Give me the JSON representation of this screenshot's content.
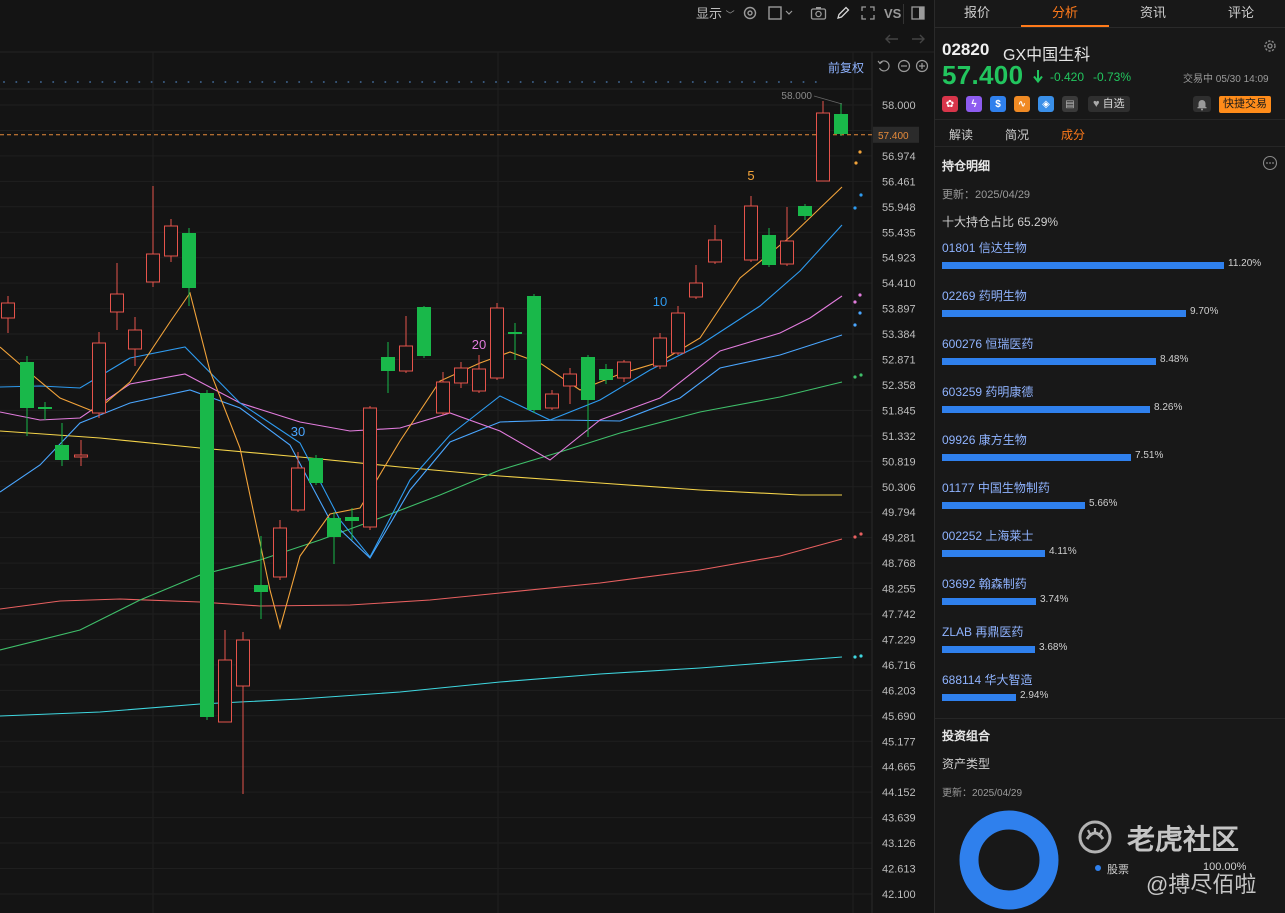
{
  "toolbar": {
    "display_label": "显示",
    "vs_label": "VS"
  },
  "chart": {
    "adj_label": "前复权",
    "current_price_label": "57.400",
    "high_label": "58.000",
    "ma_period_labels": [
      "5",
      "10",
      "20",
      "30"
    ],
    "y_axis": [
      "58.000",
      "57.487",
      "56.974",
      "56.461",
      "55.948",
      "55.435",
      "54.923",
      "54.410",
      "53.897",
      "53.384",
      "52.871",
      "52.358",
      "51.845",
      "51.332",
      "50.819",
      "50.306",
      "49.794",
      "49.281",
      "48.768",
      "48.255",
      "47.742",
      "47.229",
      "46.716",
      "46.203",
      "45.690",
      "45.177",
      "44.665",
      "44.152",
      "43.639",
      "43.126",
      "42.613",
      "42.100"
    ],
    "colors": {
      "up": "#e5534b",
      "down": "#19b84a",
      "ma5": "#f2a33a",
      "ma10": "#2e9bf0",
      "ma20": "#e27cdd",
      "ma30": "#4aa6ff",
      "ma60": "#3fbf6a",
      "ma120": "#f5d44a",
      "ma250": "#e86060",
      "ma_long": "#3fd7e0"
    }
  },
  "tabs": [
    "报价",
    "分析",
    "资讯",
    "评论"
  ],
  "active_tab": "分析",
  "stock": {
    "code": "02820",
    "name": "GX中国生科",
    "price": "57.400",
    "change": "-0.420",
    "change_pct": "-0.73%",
    "status": "交易中 05/30 14:09",
    "watch_label": "自选",
    "quick_trade_label": "快捷交易"
  },
  "subtabs": [
    "解读",
    "简况",
    "成分"
  ],
  "active_subtab": "成分",
  "holdings": {
    "title": "持仓明细",
    "updated": "更新：2025/04/29",
    "top10_ratio": "十大持仓占比 65.29%",
    "items": [
      {
        "name": "01801 信达生物",
        "pct": "11.20%",
        "value": 11.2
      },
      {
        "name": "02269 药明生物",
        "pct": "9.70%",
        "value": 9.7
      },
      {
        "name": "600276 恒瑞医药",
        "pct": "8.48%",
        "value": 8.48
      },
      {
        "name": "603259 药明康德",
        "pct": "8.26%",
        "value": 8.26
      },
      {
        "name": "09926 康方生物",
        "pct": "7.51%",
        "value": 7.51
      },
      {
        "name": "01177 中国生物制药",
        "pct": "5.66%",
        "value": 5.66
      },
      {
        "name": "002252 上海莱士",
        "pct": "4.11%",
        "value": 4.11
      },
      {
        "name": "03692 翰森制药",
        "pct": "3.74%",
        "value": 3.74
      },
      {
        "name": "ZLAB 再鼎医药",
        "pct": "3.68%",
        "value": 3.68
      },
      {
        "name": "688114 华大智造",
        "pct": "2.94%",
        "value": 2.94
      }
    ]
  },
  "portfolio": {
    "title": "投资组合",
    "asset_type": "资产类型",
    "updated": "更新：2025/04/29",
    "legend": [
      {
        "name": "股票",
        "value": "100.00%"
      }
    ]
  },
  "watermark": {
    "line1": "老虎社区",
    "line2": "@搏尽佰啦"
  }
}
